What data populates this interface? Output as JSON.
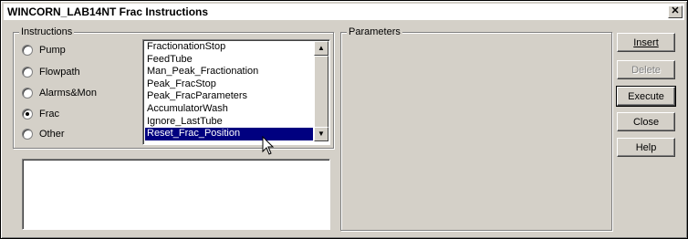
{
  "window": {
    "title": "WINCORN_LAB14NT Frac Instructions",
    "close_glyph": "✕"
  },
  "instructions": {
    "legend": "Instructions",
    "radios": [
      {
        "label": "Pump",
        "checked": false
      },
      {
        "label": "Flowpath",
        "checked": false
      },
      {
        "label": "Alarms&Mon",
        "checked": false
      },
      {
        "label": "Frac",
        "checked": true
      },
      {
        "label": "Other",
        "checked": false
      }
    ],
    "list_items": [
      "FractionationStop",
      "FeedTube",
      "Man_Peak_Fractionation",
      "Peak_FracStop",
      "Peak_FracParameters",
      "AccumulatorWash",
      "Ignore_LastTube",
      "Reset_Frac_Position"
    ],
    "selected_item": "Reset_Frac_Position",
    "scroll_up_glyph": "▲",
    "scroll_down_glyph": "▼"
  },
  "parameters": {
    "legend": "Parameters"
  },
  "buttons": {
    "insert": "Insert",
    "delete": "Delete",
    "execute": "Execute",
    "close": "Close",
    "help": "Help"
  },
  "icons": {
    "cursor": "mouse-pointer-icon",
    "close": "close-icon"
  }
}
